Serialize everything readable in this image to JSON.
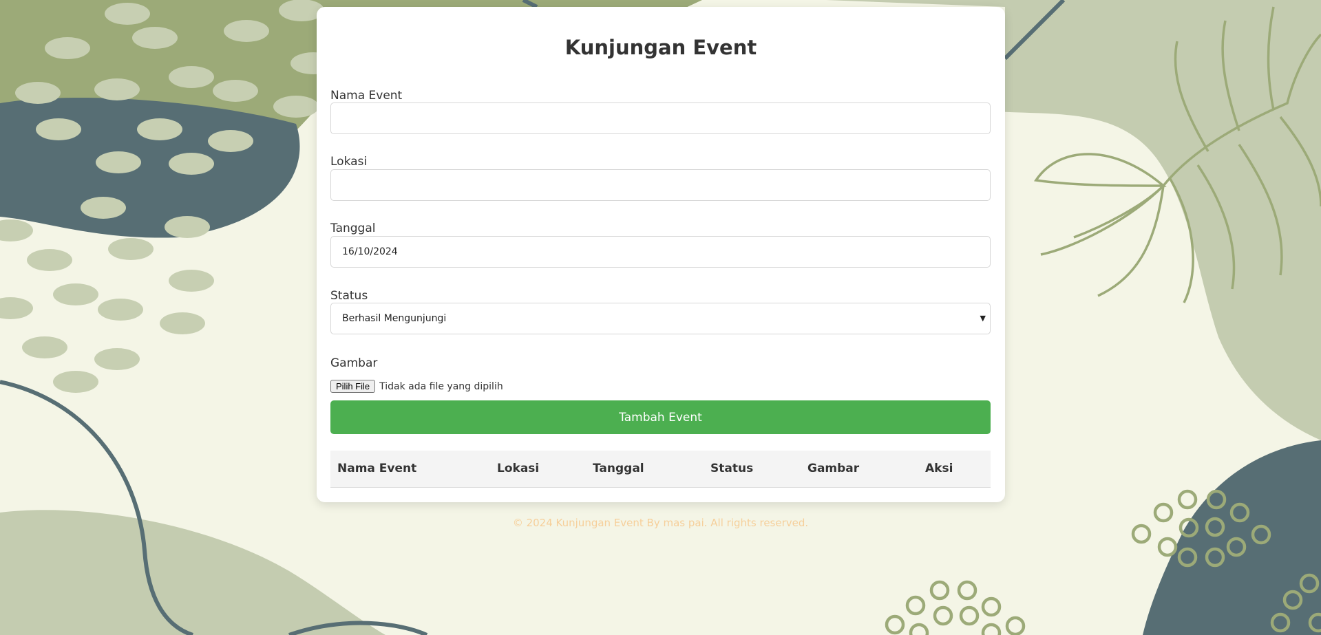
{
  "form": {
    "title": "Kunjungan Event",
    "nama_event_label": "Nama Event",
    "nama_event_value": "",
    "lokasi_label": "Lokasi",
    "lokasi_value": "",
    "tanggal_label": "Tanggal",
    "tanggal_value": "16/10/2024",
    "status_label": "Status",
    "status_value": "Berhasil Mengunjungi",
    "gambar_label": "Gambar",
    "file_button": "Pilih File",
    "file_status": "Tidak ada file yang dipilih",
    "submit_label": "Tambah Event"
  },
  "table": {
    "headers": [
      "Nama Event",
      "Lokasi",
      "Tanggal",
      "Status",
      "Gambar",
      "Aksi"
    ],
    "rows": []
  },
  "footer": "© 2024 Kunjungan Event By mas pai. All rights reserved.",
  "colors": {
    "background": "#f4f5e6",
    "accent_button": "#4caf50",
    "footer_text": "#f6cf9a",
    "sage": "#9caa78",
    "slate": "#576e74"
  }
}
